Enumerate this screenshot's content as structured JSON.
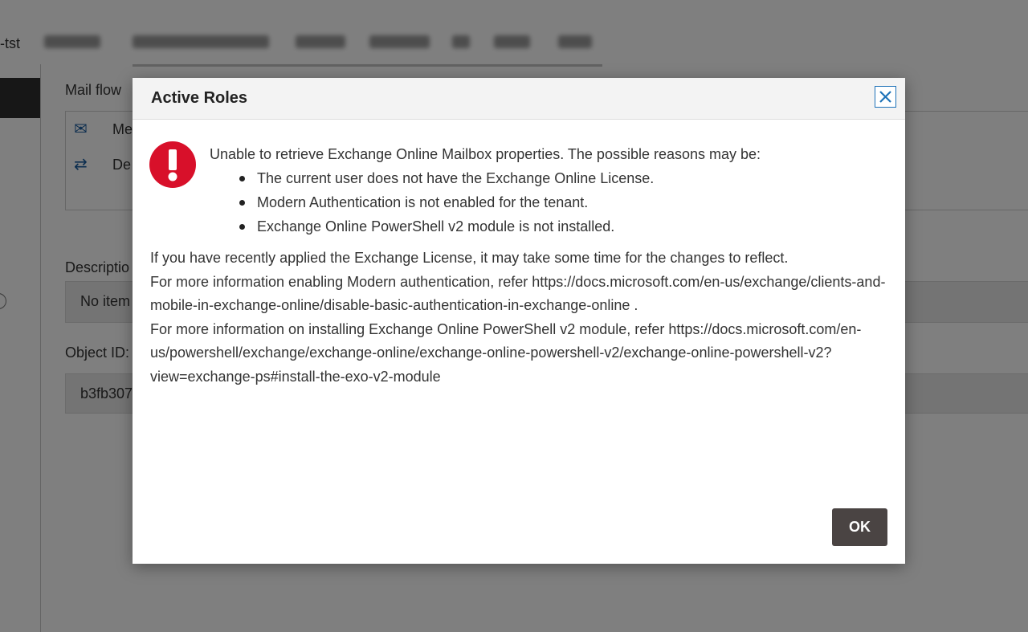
{
  "background": {
    "breadcrumb_prefix": "-tst",
    "labels": {
      "mail_flow": "Mail flow",
      "description": "Descriptio",
      "object_id": "Object ID:"
    },
    "mail_flow_rows": [
      "Me",
      "De"
    ],
    "description_value": "No item",
    "object_id_value": "b3fb307"
  },
  "dialog": {
    "title": "Active Roles",
    "error_intro": "Unable to retrieve Exchange Online Mailbox properties. The possible reasons may be:",
    "reasons": [
      "The current user does not have the Exchange Online License.",
      "Modern Authentication is not enabled for the tenant.",
      "Exchange Online PowerShell v2 module is not installed."
    ],
    "details": [
      "If you have recently applied the Exchange License, it may take some time for the changes to reflect.",
      "For more information enabling Modern authentication, refer https://docs.microsoft.com/en-us/exchange/clients-and-mobile-in-exchange-online/disable-basic-authentication-in-exchange-online .",
      "For more information on installing Exchange Online PowerShell v2 module, refer https://docs.microsoft.com/en-us/powershell/exchange/exchange-online/exchange-online-powershell-v2/exchange-online-powershell-v2?view=exchange-ps#install-the-exo-v2-module"
    ],
    "ok_label": "OK",
    "icons": {
      "close": "close-icon",
      "error": "error-icon"
    },
    "colors": {
      "error_red": "#d8102a",
      "close_blue": "#1e72b8",
      "ok_button": "#4a4443"
    }
  }
}
